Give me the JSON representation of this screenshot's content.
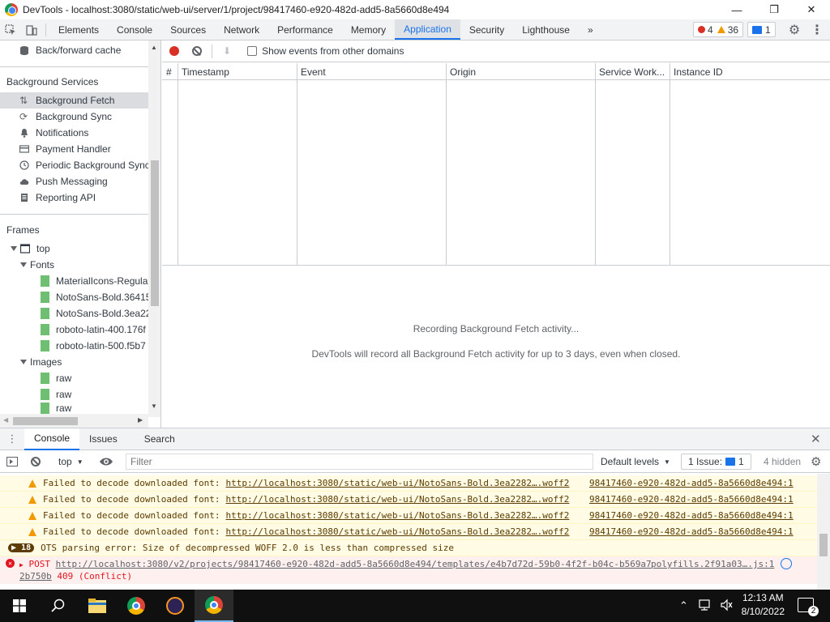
{
  "window": {
    "title": "DevTools - localhost:3080/static/web-ui/server/1/project/98417460-e920-482d-add5-8a5660d8e494",
    "minimize": "—",
    "restore": "❐",
    "close": "✕"
  },
  "tabs": [
    "Elements",
    "Console",
    "Sources",
    "Network",
    "Performance",
    "Memory",
    "Application",
    "Security",
    "Lighthouse"
  ],
  "tabs_more": "»",
  "badges": {
    "errors": "4",
    "warnings": "36",
    "messages": "1"
  },
  "sidebar": {
    "bfcache": "Back/forward cache",
    "bg_services_heading": "Background Services",
    "bg_services": [
      "Background Fetch",
      "Background Sync",
      "Notifications",
      "Payment Handler",
      "Periodic Background Sync",
      "Push Messaging",
      "Reporting API"
    ],
    "frames_heading": "Frames",
    "frame_top": "top",
    "fonts_label": "Fonts",
    "fonts": [
      "MaterialIcons-Regular",
      "NotoSans-Bold.36415",
      "NotoSans-Bold.3ea22",
      "roboto-latin-400.176f",
      "roboto-latin-500.f5b7"
    ],
    "images_label": "Images",
    "images": [
      "raw",
      "raw",
      "raw"
    ]
  },
  "toolbar": {
    "show_other_domains": "Show events from other domains"
  },
  "grid_columns": [
    "#",
    "Timestamp",
    "Event",
    "Origin",
    "Service Work...",
    "Instance ID"
  ],
  "empty": {
    "title": "Recording Background Fetch activity...",
    "desc": "DevTools will record all Background Fetch activity for up to 3 days, even when closed."
  },
  "drawer_tabs": [
    "Console",
    "Issues",
    "Search"
  ],
  "console": {
    "context": "top",
    "filter_placeholder": "Filter",
    "levels": "Default levels",
    "issues": "1 Issue:",
    "issues_count": "1",
    "hidden": "4 hidden",
    "warnings": [
      {
        "text": "Failed to decode downloaded font:",
        "url": "http://localhost:3080/static/web-ui/NotoSans-Bold.3ea2282….woff2",
        "src": "98417460-e920-482d-add5-8a5660d8e494:1"
      },
      {
        "text": "Failed to decode downloaded font:",
        "url": "http://localhost:3080/static/web-ui/NotoSans-Bold.3ea2282….woff2",
        "src": "98417460-e920-482d-add5-8a5660d8e494:1"
      },
      {
        "text": "Failed to decode downloaded font:",
        "url": "http://localhost:3080/static/web-ui/NotoSans-Bold.3ea2282….woff2",
        "src": "98417460-e920-482d-add5-8a5660d8e494:1"
      },
      {
        "text": "Failed to decode downloaded font:",
        "url": "http://localhost:3080/static/web-ui/NotoSans-Bold.3ea2282….woff2",
        "src": "98417460-e920-482d-add5-8a5660d8e494:1"
      }
    ],
    "ots_count": "18",
    "ots": "OTS parsing error: Size of decompressed WOFF 2.0 is less than compressed size",
    "post_method": "POST",
    "post_url": "http://localhost:3080/v2/projects/98417460-e920-482d-add5-8a5660d8e494/templates/e4b7d72d-59b0-4f2f-b04c-b569a7",
    "post_url_cont": "2b750b",
    "post_status": "409 (Conflict)",
    "post_src": "polyfills.2f91a03….js:1"
  },
  "taskbar": {
    "time": "12:13 AM",
    "date": "8/10/2022",
    "notif_count": "2"
  },
  "colors": {
    "accent": "#1a73e8",
    "error": "#d93025",
    "warning": "#f29900"
  }
}
